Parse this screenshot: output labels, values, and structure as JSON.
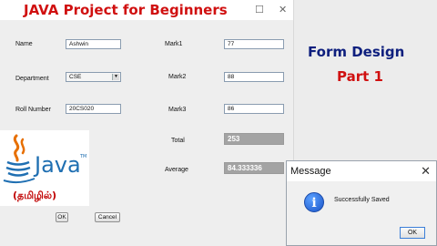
{
  "window": {
    "banner_title": "JAVA  Project for Beginners",
    "minimize_glyph": "☐",
    "close_glyph": "✕"
  },
  "form": {
    "name_label": "Name",
    "name_value": "Ashwin",
    "department_label": "Department",
    "department_value": "CSE",
    "roll_label": "Roll Number",
    "roll_value": "20CS020",
    "mark1_label": "Mark1",
    "mark1_value": "77",
    "mark2_label": "Mark2",
    "mark2_value": "88",
    "mark3_label": "Mark3",
    "mark3_value": "86",
    "total_label": "Total",
    "total_value": "253",
    "average_label": "Average",
    "average_value": "84.333336",
    "ok_label": "OK",
    "cancel_label": "Cancel"
  },
  "logo": {
    "java_text": "Java",
    "tm": "TM",
    "tamil_caption": "(தமிழில்)"
  },
  "side_text": {
    "line1": "Form Design",
    "line2": "Part  1"
  },
  "dialog": {
    "title": "Message",
    "close_glyph": "✕",
    "icon_glyph": "i",
    "message": "Successfully Saved",
    "ok_label": "OK"
  },
  "colors": {
    "banner_red": "#d01010",
    "side_navy": "#0e1f7e",
    "java_blue": "#1f6fb2",
    "java_orange": "#e76f00",
    "readonly_grey": "#a3a3a3"
  },
  "icons": [
    "java-logo-icon",
    "info-icon",
    "close-icon",
    "minimize-icon",
    "dropdown-arrow-icon"
  ]
}
